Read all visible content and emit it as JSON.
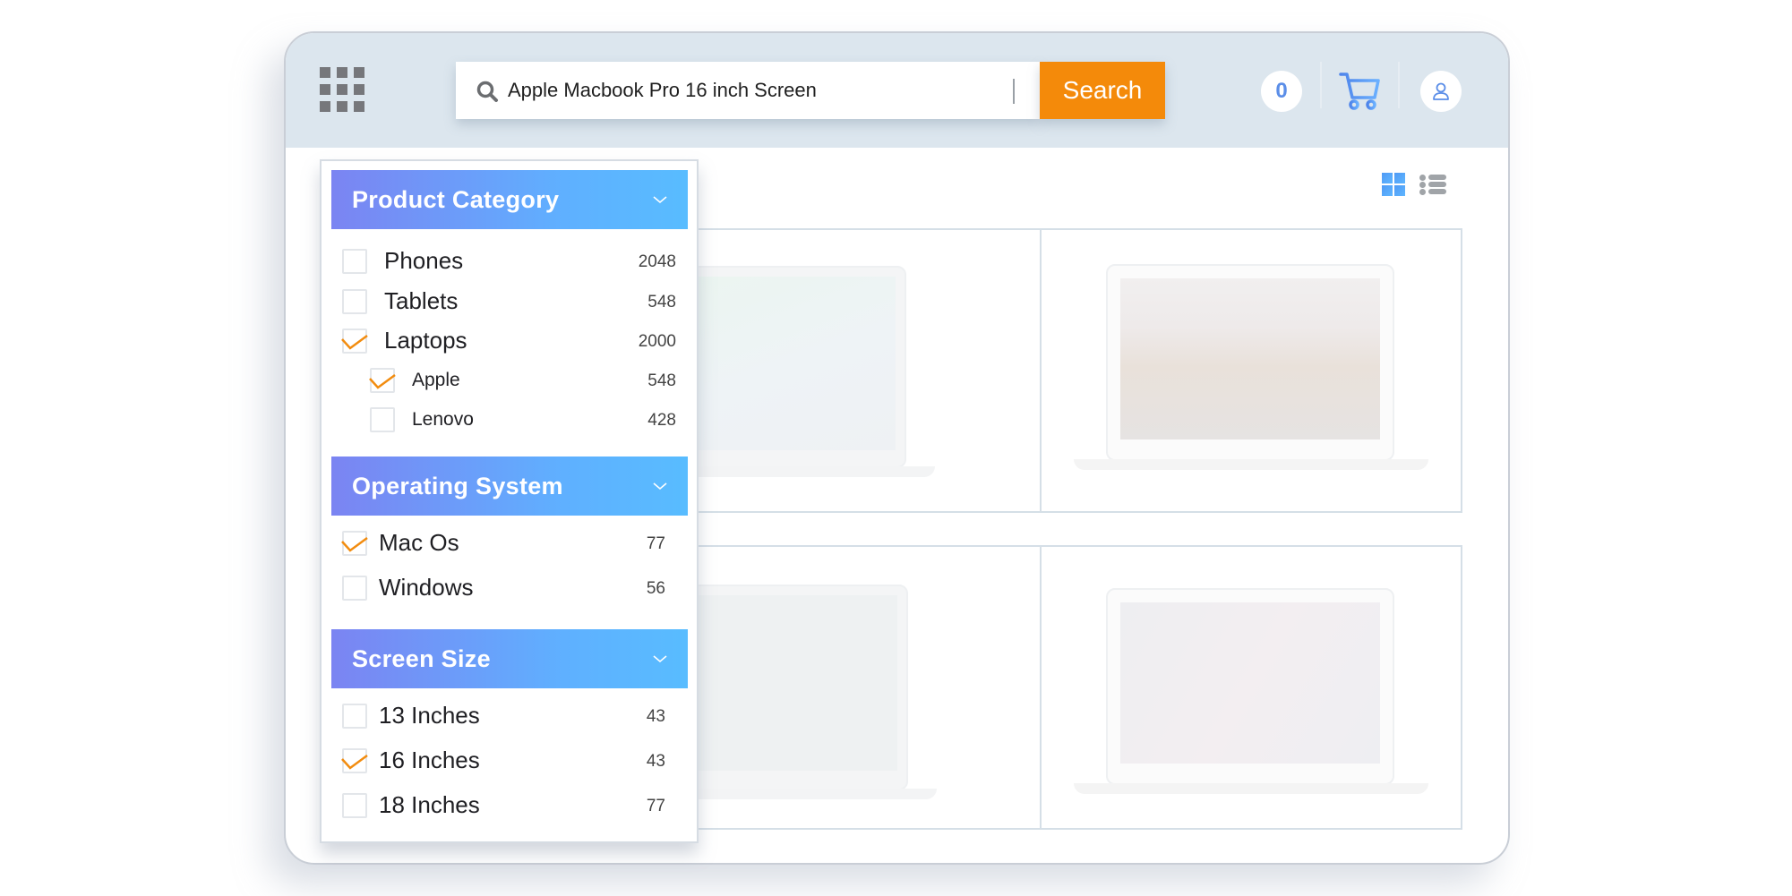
{
  "header": {
    "apps_menu_icon": "grid-9-dots-icon",
    "search": {
      "icon": "search-icon",
      "value": "Apple Macbook Pro 16 inch Screen",
      "button_label": "Search"
    },
    "badge_count": "0",
    "cart_icon": "shopping-cart-icon",
    "user_icon": "user-icon"
  },
  "view_toggle": {
    "grid_icon": "grid-view-icon",
    "list_icon": "list-view-icon",
    "active": "grid"
  },
  "colors": {
    "accent_orange": "#f48a0a",
    "header_gradient_start": "#7b84f2",
    "header_gradient_end": "#58bcff",
    "topbar_bg": "#dce6ee",
    "check_color": "#f28c0f"
  },
  "filters": {
    "product_category": {
      "title": "Product Category",
      "options": [
        {
          "label": "Phones",
          "count": "2048",
          "checked": false,
          "level": 0
        },
        {
          "label": "Tablets",
          "count": "548",
          "checked": false,
          "level": 0
        },
        {
          "label": "Laptops",
          "count": "2000",
          "checked": true,
          "level": 0
        },
        {
          "label": "Apple",
          "count": "548",
          "checked": true,
          "level": 1
        },
        {
          "label": "Lenovo",
          "count": "428",
          "checked": false,
          "level": 1
        }
      ]
    },
    "operating_system": {
      "title": "Operating System",
      "options": [
        {
          "label": "Mac Os",
          "count": "77",
          "checked": true
        },
        {
          "label": "Windows",
          "count": "56",
          "checked": false
        }
      ]
    },
    "screen_size": {
      "title": "Screen Size",
      "options": [
        {
          "label": "13 Inches",
          "count": "43",
          "checked": false
        },
        {
          "label": "16 Inches",
          "count": "43",
          "checked": true
        },
        {
          "label": "18 Inches",
          "count": "77",
          "checked": false
        }
      ]
    }
  },
  "products": [
    {
      "image": "macbook-pro-green-wallpaper"
    },
    {
      "image": "macbook-sierra-mountain-wallpaper"
    },
    {
      "image": "macbook-pro-light-wallpaper"
    },
    {
      "image": "macbook-air-galaxy-wallpaper"
    }
  ]
}
